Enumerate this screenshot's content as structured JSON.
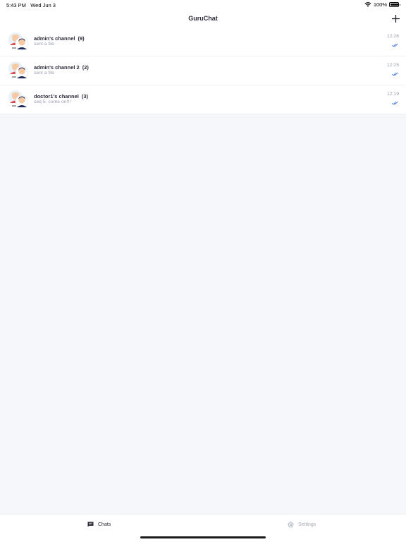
{
  "status_bar": {
    "time": "5:43 PM",
    "date": "Wed Jun 3",
    "battery": "100%",
    "battery_level": 1.0
  },
  "header": {
    "title": "GuruChat",
    "add_icon": "plus-icon"
  },
  "channels": [
    {
      "name": "admin's channel",
      "count": "(9)",
      "preview": "sent a file",
      "time": "12:26",
      "status_icon": "double-check-icon"
    },
    {
      "name": "admin's channel 2",
      "count": "(2)",
      "preview": "sent a file",
      "time": "12:25",
      "status_icon": "double-check-icon"
    },
    {
      "name": "doctor1's channel",
      "count": "(3)",
      "preview": "seq 5: come on!!!",
      "time": "12:19",
      "status_icon": "double-check-icon"
    }
  ],
  "tabs": [
    {
      "label": "Chats",
      "icon": "chat-bubble-icon",
      "active": true
    },
    {
      "label": "Settings",
      "icon": "settings-icon",
      "active": false
    }
  ],
  "colors": {
    "accent": "#3b6fe0",
    "background": "#f6f7fa",
    "muted_text": "#9a9eae"
  }
}
